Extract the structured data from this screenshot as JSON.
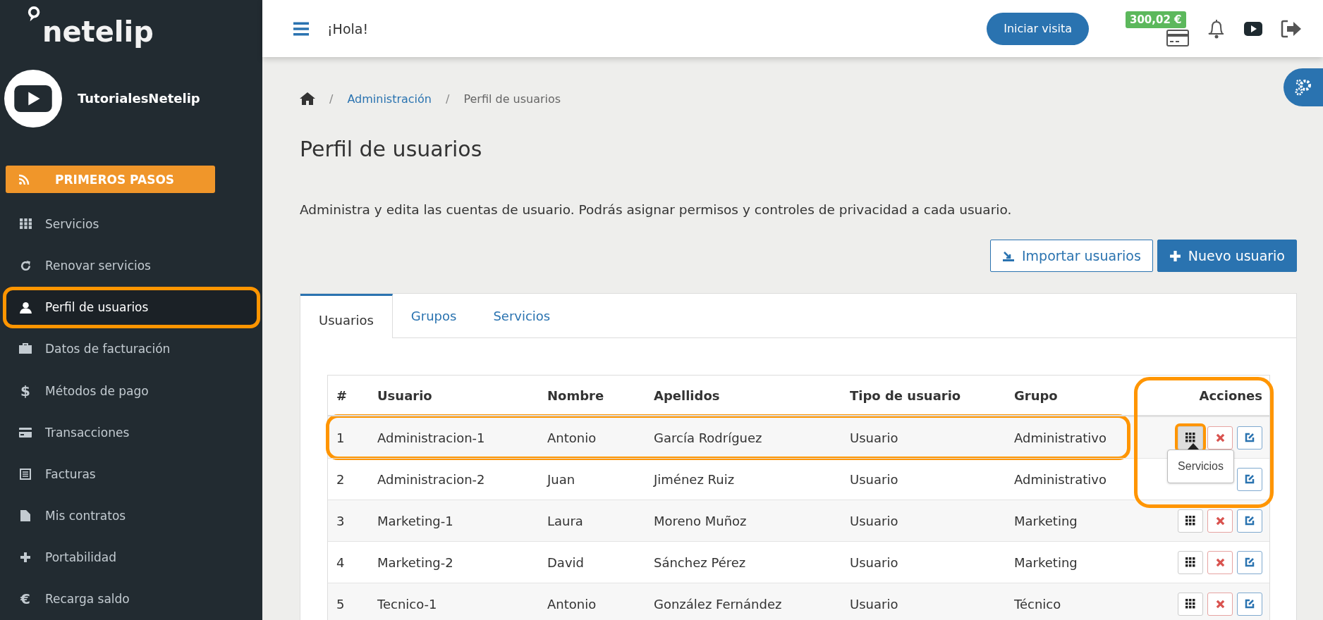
{
  "brand": {
    "logo": "netelip"
  },
  "channel": {
    "name": "TutorialesNetelip"
  },
  "sidebar": {
    "cta": "PRIMEROS PASOS",
    "items": [
      {
        "label": "Servicios",
        "kind": "grid",
        "selected": false,
        "highlighted": false
      },
      {
        "label": "Renovar servicios",
        "kind": "refresh",
        "selected": false,
        "highlighted": false
      },
      {
        "label": "Perfil de usuarios",
        "kind": "user",
        "selected": true,
        "highlighted": true
      },
      {
        "label": "Datos de facturación",
        "kind": "briefcase",
        "selected": false,
        "highlighted": false
      },
      {
        "label": "Métodos de pago",
        "kind": "glyph",
        "glyph": "$",
        "selected": false,
        "highlighted": false
      },
      {
        "label": "Transacciones",
        "kind": "card",
        "selected": false,
        "highlighted": false
      },
      {
        "label": "Facturas",
        "kind": "list",
        "selected": false,
        "highlighted": false
      },
      {
        "label": "Mis contratos",
        "kind": "file",
        "selected": false,
        "highlighted": false
      },
      {
        "label": "Portabilidad",
        "kind": "plus",
        "selected": false,
        "highlighted": false
      },
      {
        "label": "Recarga saldo",
        "kind": "glyph",
        "glyph": "€",
        "selected": false,
        "highlighted": false
      }
    ]
  },
  "header": {
    "greeting": "¡Hola!",
    "visit_button": "Iniciar visita",
    "balance": "300,02 €"
  },
  "breadcrumb": {
    "separator": "/",
    "items": [
      {
        "label": "Administración",
        "current": false
      },
      {
        "label": "Perfil de usuarios",
        "current": true
      }
    ]
  },
  "page": {
    "title": "Perfil de usuarios",
    "description": "Administra y edita las cuentas de usuario. Podrás asignar permisos y controles de privacidad a cada usuario."
  },
  "buttons": [
    {
      "label": "Importar usuarios",
      "kind": "outline"
    },
    {
      "label": "Nuevo usuario",
      "kind": "primary"
    }
  ],
  "tabs": [
    {
      "label": "Usuarios",
      "selected": true
    },
    {
      "label": "Grupos",
      "selected": false
    },
    {
      "label": "Servicios",
      "selected": false
    }
  ],
  "table": {
    "columns": [
      "#",
      "Usuario",
      "Nombre",
      "Apellidos",
      "Tipo de usuario",
      "Grupo",
      "Acciones"
    ],
    "actions_highlighted": true,
    "rows": [
      {
        "cells": [
          "1",
          "Administracion-1",
          "Antonio",
          "García Rodríguez",
          "Usuario",
          "Administrativo"
        ],
        "highlighted": true,
        "services_focused": true,
        "tooltip": "Servicios"
      },
      {
        "cells": [
          "2",
          "Administracion-2",
          "Juan",
          "Jiménez Ruiz",
          "Usuario",
          "Administrativo"
        ],
        "highlighted": false
      },
      {
        "cells": [
          "3",
          "Marketing-1",
          "Laura",
          "Moreno Muñoz",
          "Usuario",
          "Marketing"
        ],
        "highlighted": false,
        "services_focused": false
      },
      {
        "cells": [
          "4",
          "Marketing-2",
          "David",
          "Sánchez Pérez",
          "Usuario",
          "Marketing"
        ],
        "highlighted": false,
        "services_focused": false
      },
      {
        "cells": [
          "5",
          "Tecnico-1",
          "Antonio",
          "González Fernández",
          "Usuario",
          "Técnico"
        ],
        "highlighted": false,
        "services_focused": false
      }
    ]
  }
}
